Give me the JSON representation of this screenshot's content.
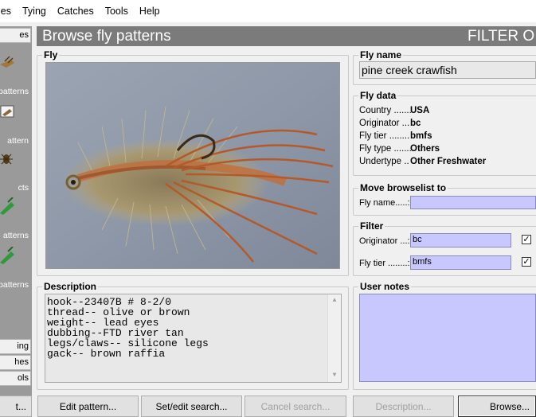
{
  "menu": [
    "ies",
    "Tying",
    "Catches",
    "Tools",
    "Help"
  ],
  "sidebar": {
    "top_tab": "es",
    "items": [
      {
        "label": "patterns",
        "icon": "fly-icon"
      },
      {
        "label": "attern",
        "icon": "fly-pattern-icon"
      },
      {
        "label": "cts",
        "icon": "insect-icon"
      },
      {
        "label": "atterns",
        "icon": "green-fly-icon"
      },
      {
        "label": "patterns",
        "icon": "green-fly-icon"
      }
    ],
    "bottom_tabs": [
      "ing",
      "hes",
      "ols"
    ]
  },
  "title": {
    "left": "Browse fly patterns",
    "right": "FILTER O"
  },
  "fly_panel": {
    "legend": "Fly"
  },
  "description": {
    "legend": "Description",
    "lines": [
      "hook--23407B # 8-2/0",
      "thread-- olive or brown",
      "weight-- lead eyes",
      "dubbing--FTD river tan",
      "legs/claws-- silicone legs",
      "gack-- brown raffia"
    ]
  },
  "fly_name": {
    "legend": "Fly name",
    "value": "pine creek crawfish"
  },
  "fly_data": {
    "legend": "Fly data",
    "rows": [
      {
        "key": "Country .......",
        "value": "USA"
      },
      {
        "key": "Originator ...",
        "value": "bc"
      },
      {
        "key": "Fly tier ........",
        "value": "bmfs"
      },
      {
        "key": "Fly type .......",
        "value": "Others"
      },
      {
        "key": "Undertype ..",
        "value": "Other Freshwater"
      }
    ]
  },
  "move_browselist": {
    "legend": "Move browselist to",
    "label": "Fly name.....:",
    "value": ""
  },
  "filter": {
    "legend": "Filter",
    "originator_label": "Originator ...:",
    "originator_value": "bc",
    "originator_checked": true,
    "tier_label": "Fly tier ........:",
    "tier_value": "bmfs",
    "tier_checked": true
  },
  "user_notes": {
    "legend": "User notes",
    "value": ""
  },
  "buttons": {
    "first": "t...",
    "edit": "Edit pattern...",
    "search": "Set/edit search...",
    "cancel": "Cancel search...",
    "description": "Description...",
    "browse": "Browse..."
  },
  "colors": {
    "title_bar": "#7b7b7b",
    "sidebar": "#9a9a9a",
    "input_fill": "#c8c8ff"
  }
}
